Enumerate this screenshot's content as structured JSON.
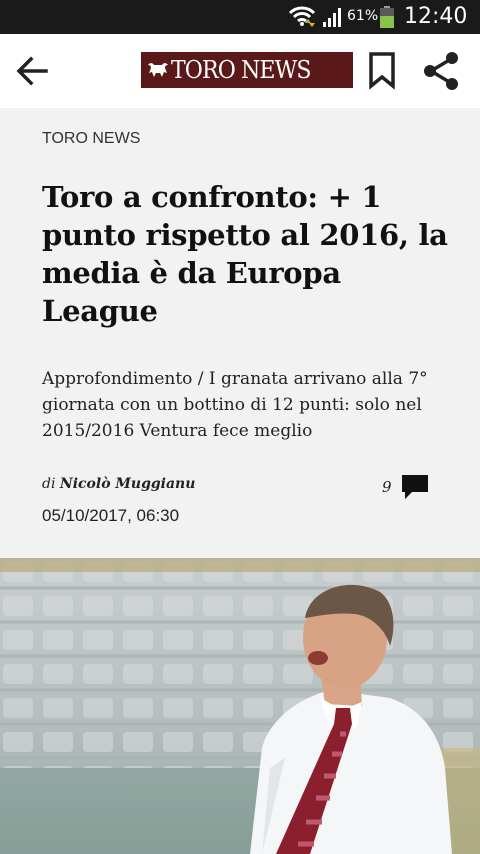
{
  "status_bar": {
    "battery_percent_text": "61%",
    "battery_level": 0.61,
    "time": "12:40"
  },
  "app_bar": {
    "logo_text": "TORO NEWS",
    "icons": [
      "back-arrow-icon",
      "bookmark-icon",
      "share-icon"
    ]
  },
  "article": {
    "section": "TORO NEWS",
    "title": "Toro a confronto: + 1 punto rispetto al 2016, la media è da Europa League",
    "subtitle": "Approfondimento / I granata arrivano alla 7° giornata con un bottino di 12 punti: solo nel 2015/2016 Ventura fece meglio",
    "author_prefix": "di",
    "author_name": "Nicolò Muggianu",
    "comment_count": "9",
    "date": "05/10/2017, 06:30"
  },
  "colors": {
    "logo_background": "#5b1818",
    "header_background": "#f2f2f2",
    "status_bar": "#1a1a1a",
    "tie": "#8b1f2e"
  }
}
